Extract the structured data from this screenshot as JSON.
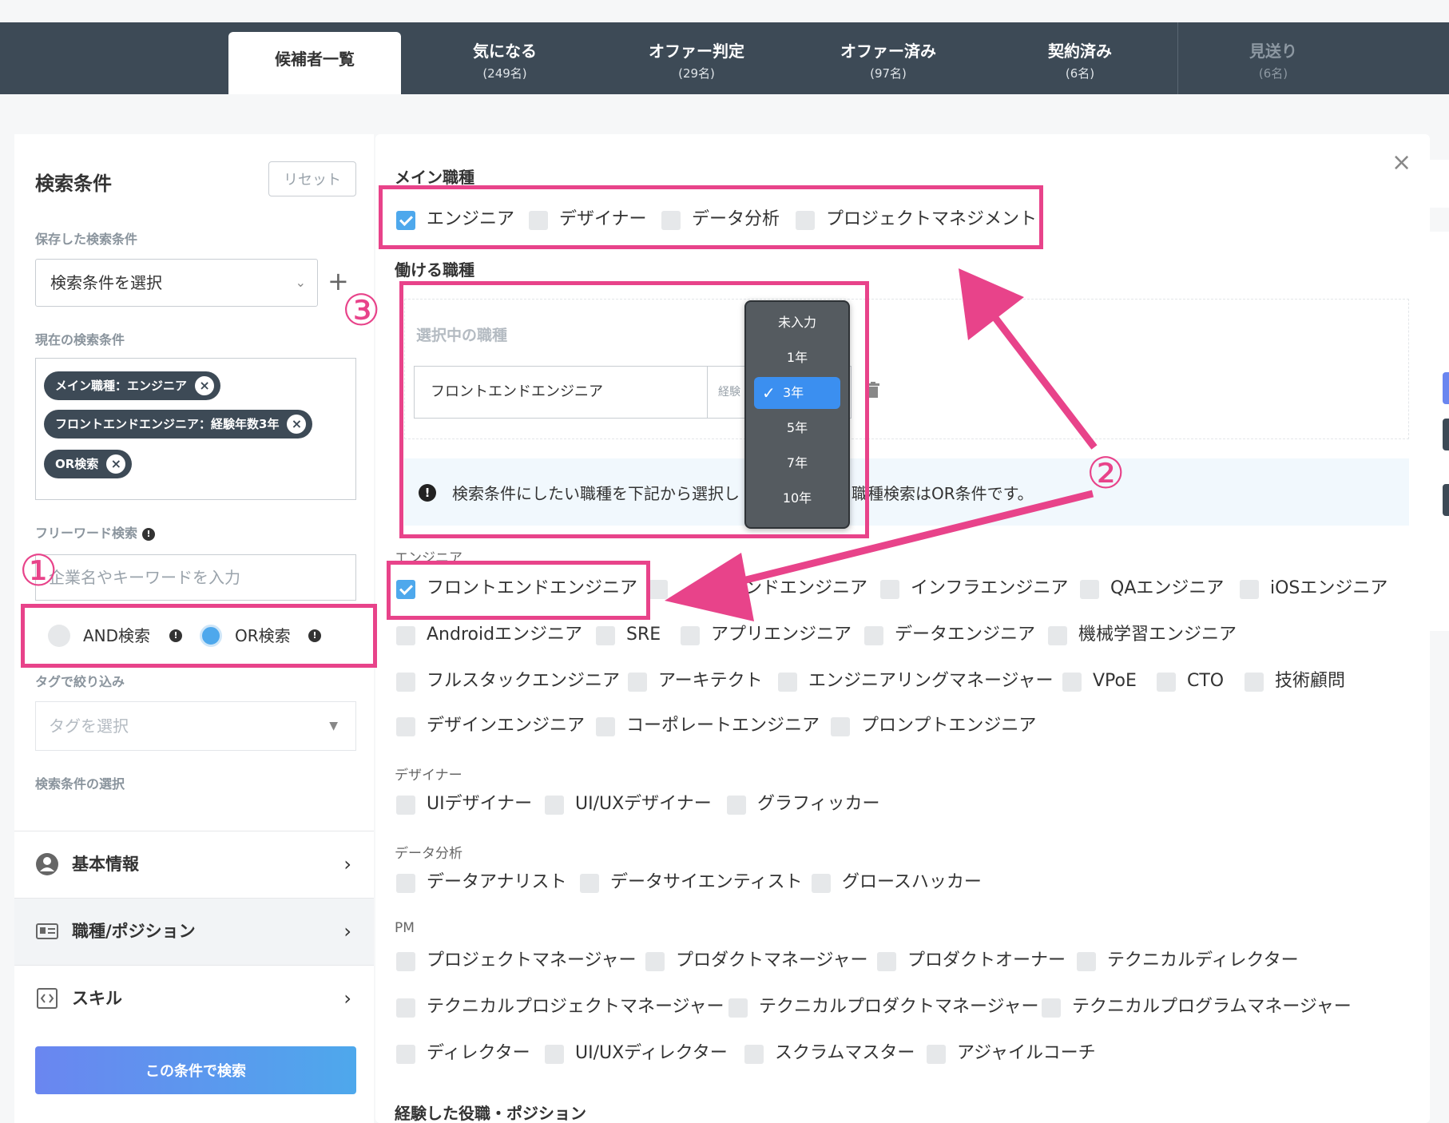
{
  "tabs": [
    {
      "label": "候補者一覧",
      "count": ""
    },
    {
      "label": "気になる",
      "count": "(249名)"
    },
    {
      "label": "オファー判定",
      "count": "(29名)"
    },
    {
      "label": "オファー済み",
      "count": "(97名)"
    },
    {
      "label": "契約済み",
      "count": "(6名)"
    },
    {
      "label": "見送り",
      "count": "(6名)"
    }
  ],
  "sidebar": {
    "title": "検索条件",
    "reset_label": "リセット",
    "saved_label": "保存した検索条件",
    "saved_select_value": "検索条件を選択",
    "current_label": "現在の検索条件",
    "chips": [
      "メイン職種：エンジニア",
      "フロントエンドエンジニア：経験年数3年",
      "OR検索"
    ],
    "freeword_label": "フリーワード検索",
    "freeword_placeholder": "企業名やキーワードを入力",
    "and_label": "AND検索",
    "or_label": "OR検索",
    "selected_mode": "OR",
    "tag_label": "タグで絞り込み",
    "tag_placeholder": "タグを選択",
    "condition_label": "検索条件の選択",
    "nav": [
      {
        "label": "基本情報",
        "icon": "user-circle-icon"
      },
      {
        "label": "職種/ポジション",
        "icon": "id-card-icon"
      },
      {
        "label": "スキル",
        "icon": "code-icon"
      }
    ],
    "search_button": "この条件で検索"
  },
  "main": {
    "main_job_heading": "メイン職種",
    "main_jobs": [
      {
        "label": "エンジニア",
        "checked": true
      },
      {
        "label": "デザイナー",
        "checked": false
      },
      {
        "label": "データ分析",
        "checked": false
      },
      {
        "label": "プロジェクトマネジメント",
        "checked": false
      }
    ],
    "work_job_heading": "働ける職種",
    "selected_heading": "選択中の職種",
    "selected_job": "フロントエンドエンジニア",
    "experience_placeholder": "経験",
    "notice_text_1": "検索条件にしたい職種を下記から選択し",
    "notice_text_2": "職種検索はOR条件です。",
    "dropdown": [
      "未入力",
      "1年",
      "3年",
      "5年",
      "7年",
      "10年"
    ],
    "dropdown_selected": "3年",
    "categories": {
      "engineer": {
        "label": "エンジニア",
        "row1": [
          "フロントエンドエンジニア",
          "エンドエンジニア",
          "インフラエンジニア",
          "QAエンジニア",
          "iOSエンジニア"
        ],
        "row2": [
          "Androidエンジニア",
          "SRE",
          "アプリエンジニア",
          "データエンジニア",
          "機械学習エンジニア"
        ],
        "row3": [
          "フルスタックエンジニア",
          "アーキテクト",
          "エンジニアリングマネージャー",
          "VPoE",
          "CTO",
          "技術顧問"
        ],
        "row4": [
          "デザインエンジニア",
          "コーポレートエンジニア",
          "プロンプトエンジニア"
        ]
      },
      "designer": {
        "label": "デザイナー",
        "items": [
          "UIデザイナー",
          "UI/UXデザイナー",
          "グラフィッカー"
        ]
      },
      "data": {
        "label": "データ分析",
        "items": [
          "データアナリスト",
          "データサイエンティスト",
          "グロースハッカー"
        ]
      },
      "pm": {
        "label": "PM",
        "row1": [
          "プロジェクトマネージャー",
          "プロダクトマネージャー",
          "プロダクトオーナー",
          "テクニカルディレクター"
        ],
        "row2": [
          "テクニカルプロジェクトマネージャー",
          "テクニカルプロダクトマネージャー",
          "テクニカルプログラムマネージャー"
        ],
        "row3": [
          "ディレクター",
          "UI/UXディレクター",
          "スクラムマスター",
          "アジャイルコーチ"
        ]
      }
    },
    "experience_heading": "経験した役職・ポジション"
  },
  "annotations": {
    "n1": "①",
    "n2": "②",
    "n3": "③"
  },
  "colors": {
    "accent": "#4ea8ec",
    "annotation": "#e8438a",
    "topbar": "#3d4a56"
  }
}
